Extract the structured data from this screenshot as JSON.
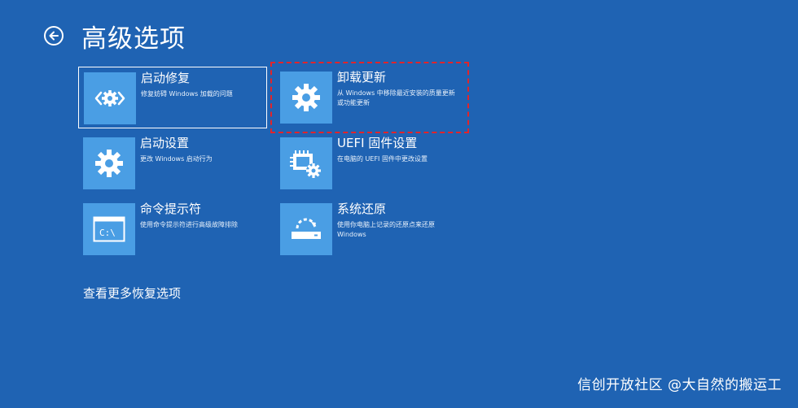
{
  "header": {
    "title": "高级选项",
    "back_icon": "back-arrow-icon"
  },
  "tiles": [
    {
      "title": "启动修复",
      "desc": "修复妨碍 Windows 加载的问题",
      "icon": "startup-repair-icon"
    },
    {
      "title": "卸载更新",
      "desc": "从 Windows 中移除最近安装的质量更新或功能更新",
      "icon": "gear-icon"
    },
    {
      "title": "启动设置",
      "desc": "更改 Windows 启动行为",
      "icon": "gear-icon"
    },
    {
      "title": "UEFI 固件设置",
      "desc": "在电脑的 UEFI 固件中更改设置",
      "icon": "firmware-icon"
    },
    {
      "title": "命令提示符",
      "desc": "使用命令提示符进行高级故障排除",
      "icon": "command-prompt-icon",
      "icon_text": "C:\\"
    },
    {
      "title": "系统还原",
      "desc": "使用你电脑上记录的还原点来还原 Windows",
      "icon": "system-restore-icon"
    }
  ],
  "more_options": "查看更多恢复选项",
  "watermark": "信创开放社区 @大自然的搬运工",
  "colors": {
    "background": "#1f63b3",
    "tile_icon_bg": "#4a9ee4",
    "highlight_border": "#e2242a"
  }
}
